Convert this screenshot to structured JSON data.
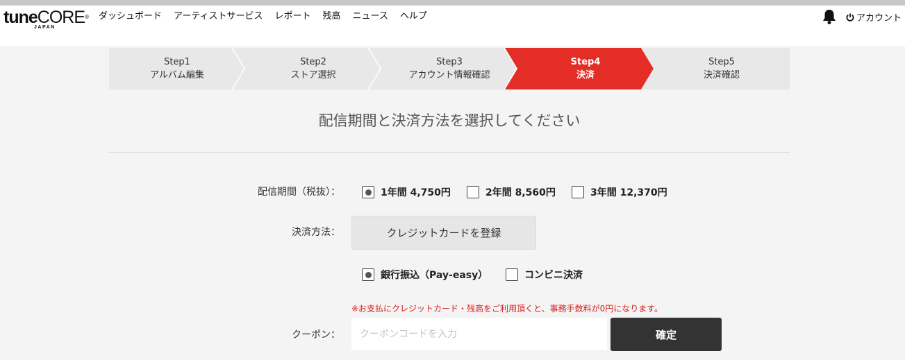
{
  "brand": {
    "logo_main_bold": "tune",
    "logo_main_light": "CORE",
    "logo_mark": "®",
    "logo_sub": "JAPAN"
  },
  "nav": {
    "items": [
      "ダッシュボード",
      "アーティストサービス",
      "レポート",
      "残高",
      "ニュース",
      "ヘルプ"
    ]
  },
  "header_right": {
    "bell_icon": "bell-icon",
    "account_icon": "power-icon",
    "account_label": "アカウント"
  },
  "steps": [
    {
      "step": "Step1",
      "label": "アルバム編集",
      "active": false
    },
    {
      "step": "Step2",
      "label": "ストア選択",
      "active": false
    },
    {
      "step": "Step3",
      "label": "アカウント情報確認",
      "active": false
    },
    {
      "step": "Step4",
      "label": "決済",
      "active": true
    },
    {
      "step": "Step5",
      "label": "決済確認",
      "active": false
    }
  ],
  "colors": {
    "active_step": "#e52d27",
    "inactive_step": "#e8e8e8",
    "note": "#d8201d",
    "confirm_button": "#333333"
  },
  "heading": "配信期間と決済方法を選択してください",
  "period": {
    "label": "配信期間（税抜）：",
    "options": [
      {
        "label": "1年間 4,750円",
        "checked": true
      },
      {
        "label": "2年間 8,560円",
        "checked": false
      },
      {
        "label": "3年間 12,370円",
        "checked": false
      }
    ]
  },
  "payment": {
    "label": "決済方法：",
    "card_button": "クレジットカードを登録",
    "options": [
      {
        "label": "銀行振込（Pay-easy）",
        "checked": true
      },
      {
        "label": "コンビニ決済",
        "checked": false
      }
    ],
    "note": "※お支払にクレジットカード・残高をご利用頂くと、事務手数料が0円になります。"
  },
  "coupon": {
    "label": "クーポン：",
    "placeholder": "クーポンコードを入力",
    "value": "",
    "confirm_label": "確定"
  }
}
